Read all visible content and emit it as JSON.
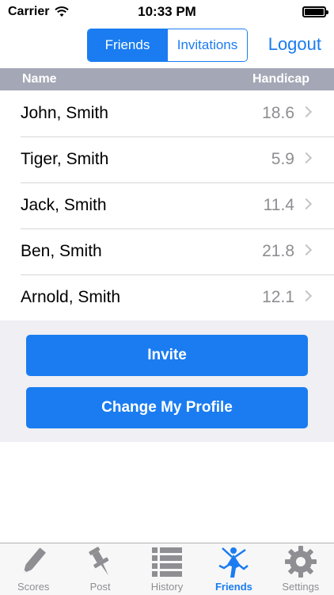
{
  "status_bar": {
    "carrier": "Carrier",
    "time": "10:33 PM"
  },
  "nav": {
    "segments": [
      {
        "label": "Friends",
        "active": true
      },
      {
        "label": "Invitations",
        "active": false
      }
    ],
    "logout_label": "Logout"
  },
  "table": {
    "columns": {
      "name": "Name",
      "handicap": "Handicap"
    },
    "rows": [
      {
        "name": "John, Smith",
        "handicap": "18.6"
      },
      {
        "name": "Tiger, Smith",
        "handicap": "5.9"
      },
      {
        "name": "Jack, Smith",
        "handicap": "11.4"
      },
      {
        "name": "Ben, Smith",
        "handicap": "21.8"
      },
      {
        "name": "Arnold, Smith",
        "handicap": "12.1"
      }
    ]
  },
  "actions": {
    "invite_label": "Invite",
    "profile_label": "Change My Profile"
  },
  "tabs": [
    {
      "label": "Scores",
      "icon": "pencil-icon"
    },
    {
      "label": "Post",
      "icon": "pushpin-icon"
    },
    {
      "label": "History",
      "icon": "list-icon"
    },
    {
      "label": "Friends",
      "icon": "golfer-icon",
      "active": true
    },
    {
      "label": "Settings",
      "icon": "gear-icon"
    }
  ],
  "colors": {
    "accent": "#1a7cf0",
    "header_bg": "#a4a7b5",
    "group_bg": "#efeff4",
    "tab_inactive": "#8e8e93"
  }
}
